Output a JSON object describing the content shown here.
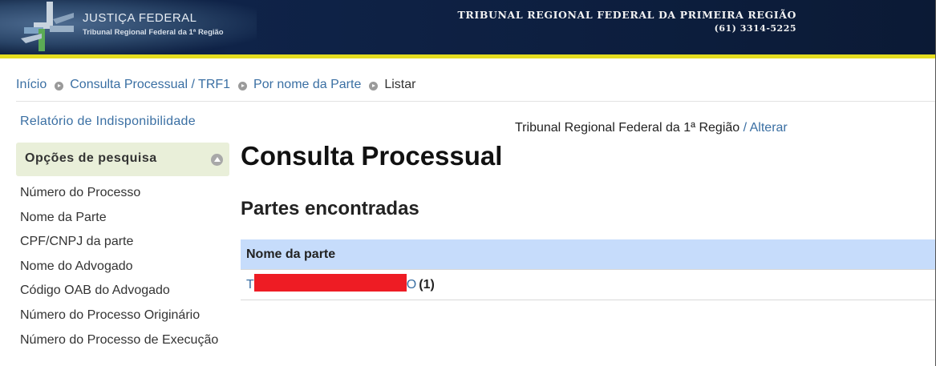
{
  "header": {
    "brand_title": "JUSTIÇA FEDERAL",
    "brand_subtitle": "Tribunal Regional Federal da 1ª Região",
    "court_name": "TRIBUNAL REGIONAL FEDERAL DA PRIMEIRA REGIÃO",
    "court_phone": "(61) 3314-5225",
    "logo_icon": "justica-federal-logo",
    "accent_color": "#e5dd1f",
    "background_color": "#0f2348"
  },
  "breadcrumb": {
    "items": [
      {
        "label": "Início"
      },
      {
        "label": "Consulta Processual / TRF1"
      },
      {
        "label": "Por nome da Parte"
      },
      {
        "label": "Listar"
      }
    ],
    "separator_icon": "circle-arrow-right-icon"
  },
  "sidebar": {
    "report_link": "Relatório de Indisponibilidade",
    "options_title": "Opções de pesquisa",
    "options_icon": "circle-arrow-up-icon",
    "items": [
      {
        "label": "Número do Processo"
      },
      {
        "label": "Nome da Parte"
      },
      {
        "label": "CPF/CNPJ da parte"
      },
      {
        "label": "Nome do Advogado"
      },
      {
        "label": "Código OAB do Advogado"
      },
      {
        "label": "Número do Processo Originário"
      },
      {
        "label": "Número do Processo de Execução"
      }
    ]
  },
  "main": {
    "tribunal_name": "Tribunal Regional Federal da 1ª Região",
    "tribunal_separator": " / ",
    "change_link": "Alterar",
    "title": "Consulta Processual",
    "section_title": "Partes encontradas",
    "table": {
      "column_header": "Nome da parte",
      "rows": [
        {
          "name_start": "T",
          "name_end": "O",
          "count": "(1)",
          "redacted": true
        }
      ]
    },
    "link_color": "#3a6fa3",
    "table_header_color": "#c6dcfb",
    "redaction_color": "#ee1c24"
  }
}
